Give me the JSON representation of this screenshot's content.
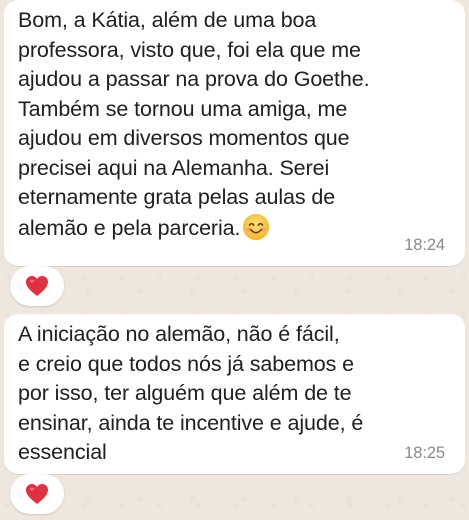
{
  "messages": [
    {
      "text": "Bom, a Kátia, além de uma boa\nprofessora, visto que, foi ela que me\najudou a passar na prova do Goethe.\nTambém se tornou uma amiga, me\najudou em diversos momentos que\nprecisei aqui na Alemanha. Serei\neternamente grata pelas aulas de\nalemão e pela parceria.",
      "emoji": "smiling-face-with-smiling-eyes",
      "time": "18:24",
      "reaction": "red-heart"
    },
    {
      "text": "A iniciação no alemão, não é fácil,\ne creio que todos nós já sabemos e\npor isso, ter alguém que além de te\nensinar, ainda te incentive e ajude, é\nessencial",
      "time": "18:25",
      "reaction": "red-heart"
    }
  ],
  "colors": {
    "bubble": "#ffffff",
    "background": "#ece5dd",
    "text": "#202020",
    "timestamp": "#8a8a8a",
    "heart": "#e0313f"
  }
}
